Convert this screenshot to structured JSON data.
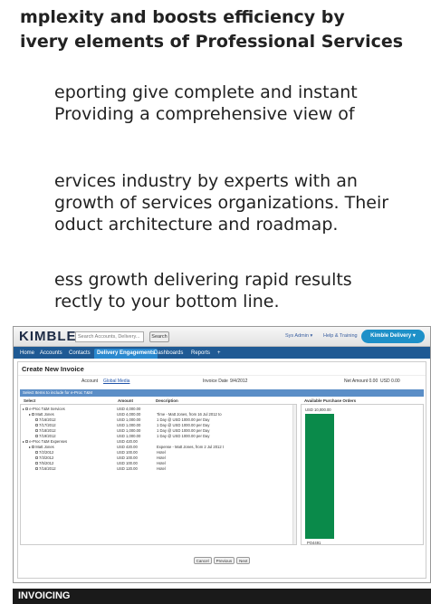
{
  "article": {
    "headline": [
      "mplexity and boosts efficiency by",
      "ivery elements of Professional Services"
    ],
    "paragraph1": [
      "eporting give complete and instant",
      "Providing a comprehensive view of"
    ],
    "paragraph2": [
      "ervices industry by experts with an",
      "growth of services organizations. Their",
      "oduct architecture and roadmap."
    ],
    "paragraph3": [
      "ess growth delivering rapid results",
      "rectly to your bottom line."
    ]
  },
  "app": {
    "logo": "KIMBLE",
    "search_placeholder": "Search Accounts, Delivery...",
    "search_button": "Search",
    "user_menu": "Sys Admin",
    "help_link": "Help & Training",
    "app_switcher": "Kimble Delivery",
    "tabs": [
      "Home",
      "Accounts",
      "Contacts",
      "Delivery Engagements",
      "Dashboards",
      "Reports",
      "+"
    ]
  },
  "invoice": {
    "title": "Create New Invoice",
    "account_label": "Account",
    "account_value": "Global Media",
    "date_label": "Invoice Date",
    "date_value": "9/4/2012",
    "net_label": "Net Amount 0.00",
    "net_value": "USD 0.00",
    "section_title": "Select Items to include for e-Proc T&M",
    "columns": {
      "select": "Select",
      "amount": "Amount",
      "description": "Description",
      "po": "Available Purchase Orders"
    },
    "rows": [
      {
        "indent": 0,
        "label": "e-Proc T&M Services",
        "amount": "USD 4,000.00",
        "desc": ""
      },
      {
        "indent": 1,
        "label": "Matt Jones",
        "amount": "USD 4,000.00",
        "desc": "Time - Matt Jones, from 16 Jul 2012 to"
      },
      {
        "indent": 2,
        "label": "7/16/2012",
        "amount": "USD 1,000.00",
        "desc": "1 Day @ USD 1000.00 per Day"
      },
      {
        "indent": 2,
        "label": "7/17/2012",
        "amount": "USD 1,000.00",
        "desc": "1 Day @ USD 1000.00 per Day"
      },
      {
        "indent": 2,
        "label": "7/18/2012",
        "amount": "USD 1,000.00",
        "desc": "1 Day @ USD 1000.00 per Day"
      },
      {
        "indent": 2,
        "label": "7/19/2012",
        "amount": "USD 1,000.00",
        "desc": "1 Day @ USD 1000.00 per Day"
      },
      {
        "indent": 0,
        "label": "e-Proc T&M Expenses",
        "amount": "USD 420.00",
        "desc": ""
      },
      {
        "indent": 1,
        "label": "Matt Jones",
        "amount": "USD 420.00",
        "desc": "Expense - Matt Jones, from 2 Jul 2012 t"
      },
      {
        "indent": 2,
        "label": "7/2/2012",
        "amount": "USD 100.00",
        "desc": "Hotel"
      },
      {
        "indent": 2,
        "label": "7/3/2012",
        "amount": "USD 100.00",
        "desc": "Hotel"
      },
      {
        "indent": 2,
        "label": "7/5/2012",
        "amount": "USD 100.00",
        "desc": "Hotel"
      },
      {
        "indent": 2,
        "label": "7/16/2012",
        "amount": "USD 120.00",
        "desc": "Hotel"
      }
    ],
    "po_amount": "USD 10,000.00",
    "po_name": "PO4491",
    "buttons": [
      "Cancel",
      "Previous",
      "Next"
    ]
  },
  "caption": "INVOICING",
  "colors": {
    "tab_bar": "#1f5a94",
    "active_tab": "#2a89cf",
    "po_bar": "#0a8a4a",
    "caption_bg": "#1a1a1a"
  }
}
